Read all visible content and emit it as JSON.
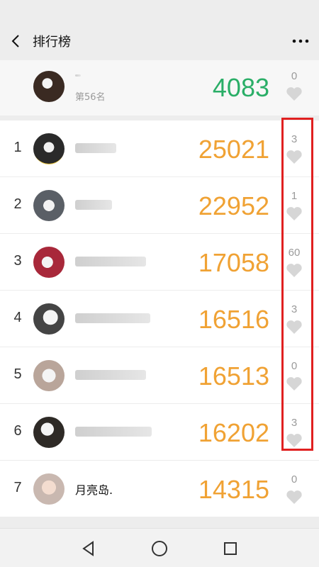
{
  "header": {
    "title": "排行榜",
    "more_icon": "more-dots-icon",
    "back_icon": "back-chevron-icon"
  },
  "me": {
    "name": "",
    "rank_text": "第56名",
    "steps": "4083",
    "likes": "0",
    "steps_color": "#2aae67"
  },
  "ranking": [
    {
      "rank": "1",
      "name": "",
      "steps": "25021",
      "likes": "3"
    },
    {
      "rank": "2",
      "name": "",
      "steps": "22952",
      "likes": "1"
    },
    {
      "rank": "3",
      "name": "",
      "steps": "17058",
      "likes": "60"
    },
    {
      "rank": "4",
      "name": "",
      "steps": "16516",
      "likes": "3"
    },
    {
      "rank": "5",
      "name": "",
      "steps": "16513",
      "likes": "0"
    },
    {
      "rank": "6",
      "name": "",
      "steps": "16202",
      "likes": "3"
    },
    {
      "rank": "7",
      "name": "月亮岛.",
      "steps": "14315",
      "likes": "0"
    }
  ],
  "colors": {
    "steps_orange": "#f0a234",
    "highlight_red": "#e02020",
    "like_gray": "#d6d6d6"
  },
  "navbar": {
    "back": "triangle-back-icon",
    "home": "circle-home-icon",
    "recent": "square-recent-icon"
  }
}
